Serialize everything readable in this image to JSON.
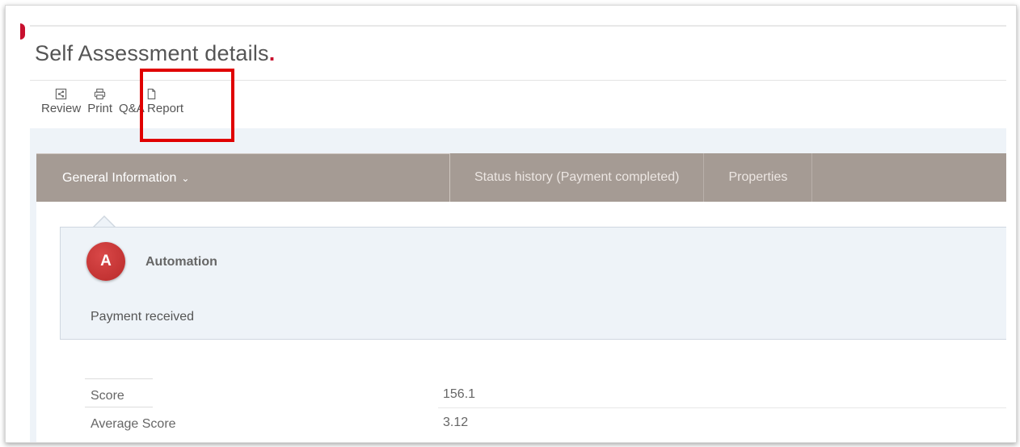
{
  "page": {
    "title": "Self Assessment details",
    "title_dot": "."
  },
  "toolbar": {
    "review_label": "Review",
    "print_label": "Print",
    "qa_report_label": "Q&A Report",
    "icons": [
      "share-icon",
      "printer-icon",
      "document-icon"
    ]
  },
  "tabs": {
    "general": "General Information",
    "status_history": "Status history (Payment completed)",
    "properties": "Properties"
  },
  "comment": {
    "avatar_letter": "A",
    "author": "Automation",
    "text": "Payment received"
  },
  "details": [
    {
      "label": "Score",
      "value": "156.1"
    },
    {
      "label": "Average Score",
      "value": "3.12"
    }
  ],
  "colors": {
    "accent": "#c8102e",
    "tab_bar": "#a59b94",
    "highlight": "#e00000",
    "panel_bg": "#eef3f8"
  }
}
